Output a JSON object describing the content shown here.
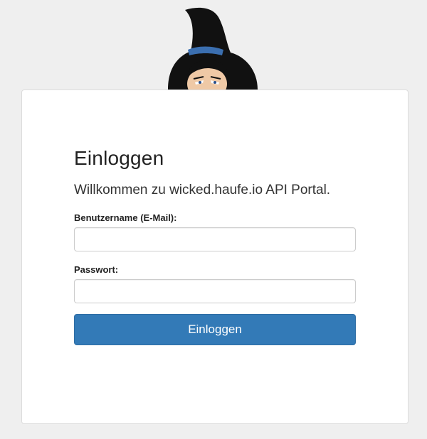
{
  "login": {
    "title": "Einloggen",
    "subtitle": "Willkommen zu wicked.haufe.io API Portal.",
    "username_label": "Benutzername (E-Mail):",
    "username_value": "",
    "username_placeholder": "",
    "password_label": "Passwort:",
    "password_value": "",
    "password_placeholder": "",
    "submit_label": "Einloggen"
  },
  "colors": {
    "background": "#efefef",
    "card": "#ffffff",
    "primary_button": "#337ab7",
    "hat": "#111111",
    "hat_band": "#3b6fb0",
    "skin": "#efc9a6"
  },
  "icons": {
    "mascot": "witch-mascot-icon"
  }
}
